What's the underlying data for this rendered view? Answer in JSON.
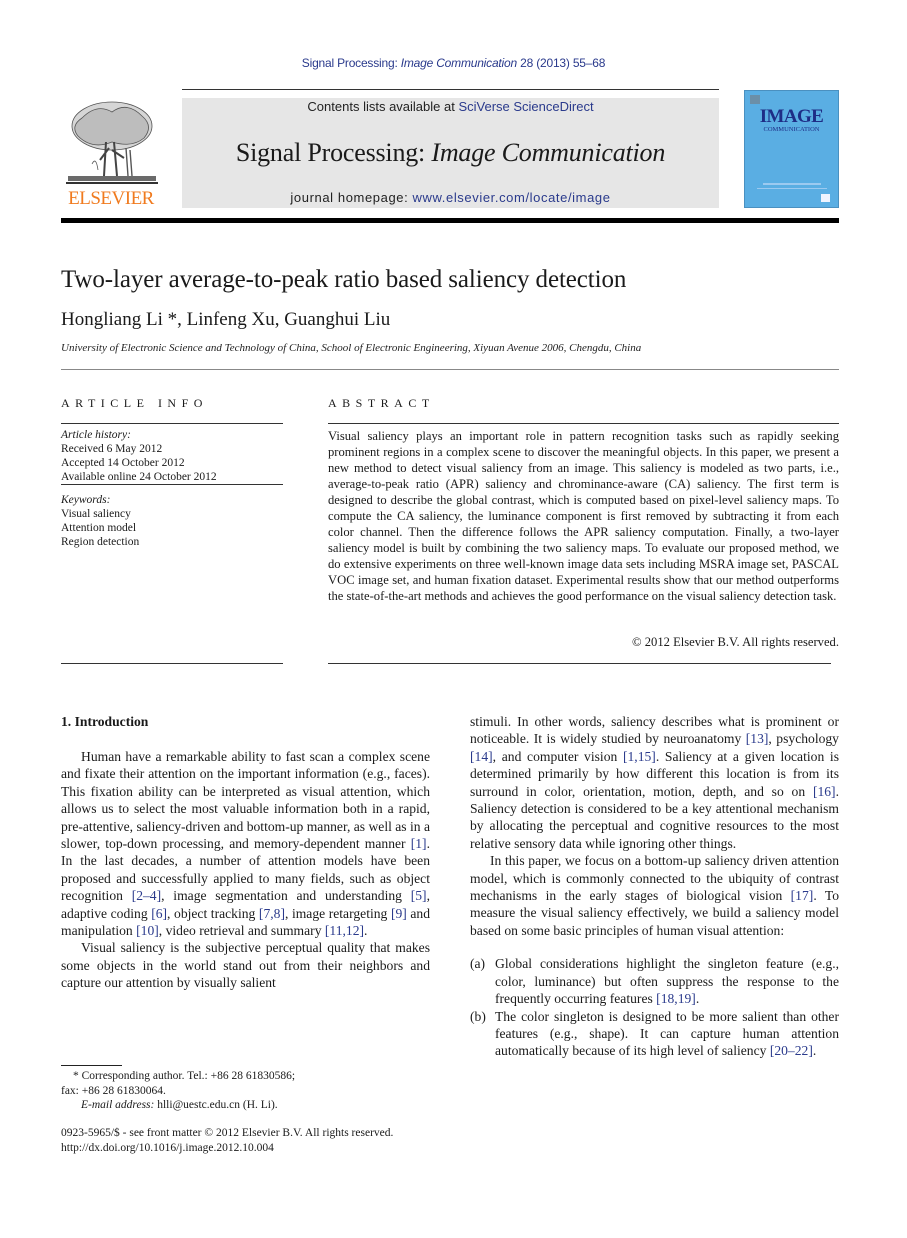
{
  "running_header": {
    "journal_plain": "Signal Processing: ",
    "journal_italic": "Image Communication",
    "volume_info": " 28 (2013) 55–68"
  },
  "masthead": {
    "publisher_wordmark": "ELSEVIER",
    "contents_prefix": "Contents lists available at ",
    "contents_link": "SciVerse ScienceDirect",
    "journal_title_plain": "Signal Processing: ",
    "journal_title_italic": "Image Communication",
    "homepage_prefix": "journal homepage: ",
    "homepage_link": "www.elsevier.com/locate/image",
    "cover_title": "IMAGE",
    "cover_subtitle": "COMMUNICATION",
    "colors": {
      "elsevier_orange": "#f07a1e",
      "link_blue": "#2a3a8c",
      "cover_blue": "#5aaee3",
      "masthead_gray": "#e6e6e6"
    }
  },
  "paper": {
    "title": "Two-layer average-to-peak ratio based saliency detection",
    "authors": "Hongliang Li *, Linfeng Xu, Guanghui Liu",
    "affiliation": "University of Electronic Science and Technology of China, School of Electronic Engineering, Xiyuan Avenue 2006, Chengdu, China"
  },
  "article_info": {
    "heading": "ARTICLE INFO",
    "history_label": "Article history:",
    "history": [
      "Received 6 May 2012",
      "Accepted 14 October 2012",
      "Available online 24 October 2012"
    ],
    "keywords_label": "Keywords:",
    "keywords": [
      "Visual saliency",
      "Attention model",
      "Region detection"
    ]
  },
  "abstract": {
    "heading": "ABSTRACT",
    "text": "Visual saliency plays an important role in pattern recognition tasks such as rapidly seeking prominent regions in a complex scene to discover the meaningful objects. In this paper, we present a new method to detect visual saliency from an image. This saliency is modeled as two parts, i.e., average-to-peak ratio (APR) saliency and chrominance-aware (CA) saliency. The first term is designed to describe the global contrast, which is computed based on pixel-level saliency maps. To compute the CA saliency, the luminance component is first removed by subtracting it from each color channel. Then the difference follows the APR saliency computation. Finally, a two-layer saliency model is built by combining the two saliency maps. To evaluate our proposed method, we do extensive experiments on three well-known image data sets including MSRA image set, PASCAL VOC image set, and human fixation dataset. Experimental results show that our method outperforms the state-of-the-art methods and achieves the good performance on the visual saliency detection task.",
    "copyright": "© 2012 Elsevier B.V. All rights reserved."
  },
  "introduction": {
    "heading": "1.  Introduction",
    "left_paragraphs": [
      [
        {
          "t": "Human have a remarkable ability to fast scan a complex scene and fixate their attention on the important information (e.g., faces). This fixation ability can be interpreted as visual attention, which allows us to select the most valuable information both in a rapid, pre-attentive, saliency-driven and bottom-up manner, as well as in a slower, top-down processing, and memory-dependent manner "
        },
        {
          "c": "[1]"
        },
        {
          "t": ". In the last decades, a number of attention models have been proposed and successfully applied to many fields, such as object recognition "
        },
        {
          "c": "[2–4]"
        },
        {
          "t": ", image segmentation and understanding "
        },
        {
          "c": "[5]"
        },
        {
          "t": ", adaptive coding "
        },
        {
          "c": "[6]"
        },
        {
          "t": ", object tracking "
        },
        {
          "c": "[7,8]"
        },
        {
          "t": ", image retargeting "
        },
        {
          "c": "[9]"
        },
        {
          "t": " and manipulation "
        },
        {
          "c": "[10]"
        },
        {
          "t": ", video retrieval and summary "
        },
        {
          "c": "[11,12]"
        },
        {
          "t": "."
        }
      ],
      [
        {
          "t": "Visual saliency is the subjective perceptual quality that makes some objects in the world stand out from their neighbors and capture our attention by visually salient"
        }
      ]
    ],
    "right_paragraphs": [
      [
        {
          "t": "stimuli. In other words, saliency describes what is prominent or noticeable. It is widely studied by neuroanatomy "
        },
        {
          "c": "[13]"
        },
        {
          "t": ", psychology "
        },
        {
          "c": "[14]"
        },
        {
          "t": ", and computer vision "
        },
        {
          "c": "[1,15]"
        },
        {
          "t": ". Saliency at a given location is determined primarily by how different this location is from its surround in color, orientation, motion, depth, and so on "
        },
        {
          "c": "[16]"
        },
        {
          "t": ". Saliency detection is considered to be a key attentional mechanism by allocating the perceptual and cognitive resources to the most relative sensory data while ignoring other things."
        }
      ],
      [
        {
          "t": "In this paper, we focus on a bottom-up saliency driven attention model, which is commonly connected to the ubiquity of contrast mechanisms in the early stages of biological vision "
        },
        {
          "c": "[17]"
        },
        {
          "t": ". To measure the visual saliency effectively, we build a saliency model based on some basic principles of human visual attention:"
        }
      ]
    ],
    "list": [
      {
        "label": "(a)",
        "parts": [
          {
            "t": "Global considerations highlight the singleton feature (e.g., color, luminance) but often suppress the response to the frequently occurring features "
          },
          {
            "c": "[18,19]"
          },
          {
            "t": "."
          }
        ]
      },
      {
        "label": "(b)",
        "parts": [
          {
            "t": "The color singleton is designed to be more salient than other features (e.g., shape). It can capture human attention automatically because of its high level of saliency "
          },
          {
            "c": "[20–22]"
          },
          {
            "t": "."
          }
        ]
      }
    ]
  },
  "footnotes": {
    "corresponding": "* Corresponding author. Tel.: +86 28 61830586;",
    "fax": "fax: +86 28 61830064.",
    "email_label": "E-mail address:",
    "email_value": " hlli@uestc.edu.cn (H. Li)."
  },
  "footer": {
    "issn_line": "0923-5965/$ - see front matter © 2012 Elsevier B.V. All rights reserved.",
    "doi": "http://dx.doi.org/10.1016/j.image.2012.10.004"
  }
}
